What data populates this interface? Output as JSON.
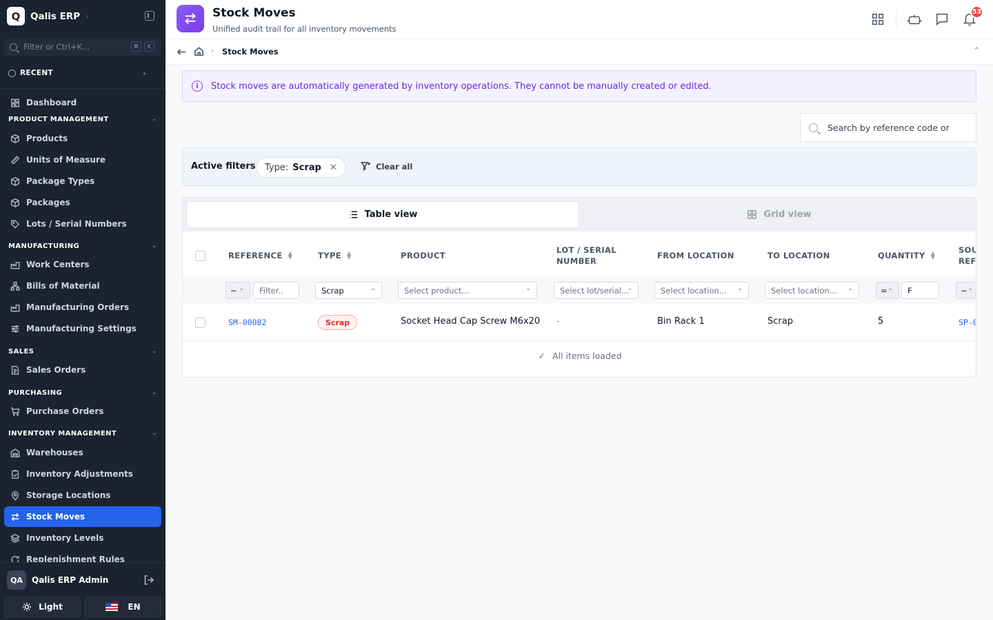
{
  "app": {
    "logo_letter": "Q",
    "name": "Qalis ERP"
  },
  "sidebar": {
    "search_placeholder": "Filter or Ctrl+K...",
    "kbd_1": "⌘",
    "kbd_2": "K",
    "recent_label": "RECENT",
    "dashboard": "Dashboard",
    "sections": {
      "product_management": "PRODUCT MANAGEMENT",
      "manufacturing": "MANUFACTURING",
      "sales": "SALES",
      "purchasing": "PURCHASING",
      "inventory_management": "INVENTORY MANAGEMENT"
    },
    "items": {
      "products": "Products",
      "units_of_measure": "Units of Measure",
      "package_types": "Package Types",
      "packages": "Packages",
      "lots_serial": "Lots / Serial Numbers",
      "work_centers": "Work Centers",
      "bills_of_material": "Bills of Material",
      "manufacturing_orders": "Manufacturing Orders",
      "manufacturing_settings": "Manufacturing Settings",
      "sales_orders": "Sales Orders",
      "purchase_orders": "Purchase Orders",
      "warehouses": "Warehouses",
      "inventory_adjustments": "Inventory Adjustments",
      "storage_locations": "Storage Locations",
      "stock_moves": "Stock Moves",
      "inventory_levels": "Inventory Levels",
      "replenishment_rules": "Replenishment Rules"
    },
    "user": {
      "initials": "QA",
      "name": "Qalis ERP Admin"
    },
    "theme_label": "Light",
    "language_label": "EN"
  },
  "header": {
    "title": "Stock Moves",
    "subtitle": "Unified audit trail for all inventory movements",
    "notification_count": "53"
  },
  "breadcrumb": {
    "current": "Stock Moves"
  },
  "notice": {
    "icon_glyph": "i",
    "text": "Stock moves are automatically generated by inventory operations. They cannot be manually created or edited."
  },
  "search": {
    "placeholder": "Search by reference code or"
  },
  "filters": {
    "label": "Active filters:",
    "chip_key": "Type:",
    "chip_value": "Scrap",
    "clear_label": "Clear all"
  },
  "views": {
    "table": "Table view",
    "grid": "Grid view"
  },
  "table": {
    "columns": {
      "reference": "REFERENCE",
      "type": "TYPE",
      "product": "PRODUCT",
      "lot_line1": "LOT / SERIAL",
      "lot_line2": "NUMBER",
      "from_location": "FROM LOCATION",
      "to_location": "TO LOCATION",
      "quantity": "QUANTITY",
      "source_line1": "SOU",
      "source_line2": "REFE"
    },
    "filter_row": {
      "ref_operator": "~",
      "ref_placeholder": "Filter..",
      "type_value": "Scrap",
      "product_placeholder": "Select product...",
      "lot_placeholder": "Select lot/serial...",
      "from_placeholder": "Select location...",
      "to_placeholder": "Select location...",
      "qty_operator": "=",
      "qty_value": "F",
      "source_operator": "~"
    },
    "rows": [
      {
        "reference": "SM-00082",
        "type": "Scrap",
        "product": "Socket Head Cap Screw M6x20",
        "lot": "-",
        "from_location": "Bin Rack 1",
        "to_location": "Scrap",
        "quantity": "5",
        "source": "SP-0"
      }
    ],
    "footer": "All items loaded"
  },
  "colors": {
    "accent": "#2563eb",
    "sidebar_bg": "#1b2230",
    "header_icon": "#7c3aed",
    "danger": "#dc2626"
  }
}
